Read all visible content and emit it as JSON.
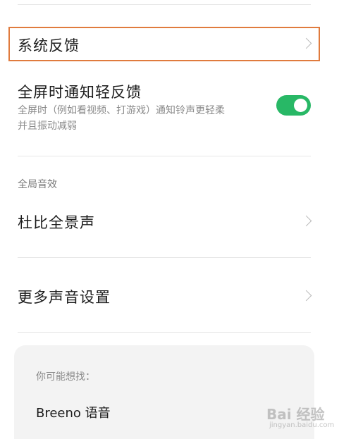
{
  "rows": {
    "system_feedback": {
      "label": "系统反馈"
    },
    "fullscreen_notify": {
      "label": "全屏时通知轻反馈",
      "desc_line1": "全屏时（例如看视频、打游戏）通知铃声更轻柔",
      "desc_line2": "并且振动减弱",
      "toggle_on": true
    },
    "section_global": "全局音效",
    "dolby": {
      "label": "杜比全景声"
    },
    "more_sound": {
      "label": "更多声音设置"
    }
  },
  "suggest_card": {
    "title": "你可能想找：",
    "item": "Breeno 语音"
  },
  "watermark": {
    "text": "Bai 经验",
    "sub": "jingyan.baidu.com"
  },
  "colors": {
    "toggle": "#28b866",
    "highlight": "#e07b3e"
  }
}
